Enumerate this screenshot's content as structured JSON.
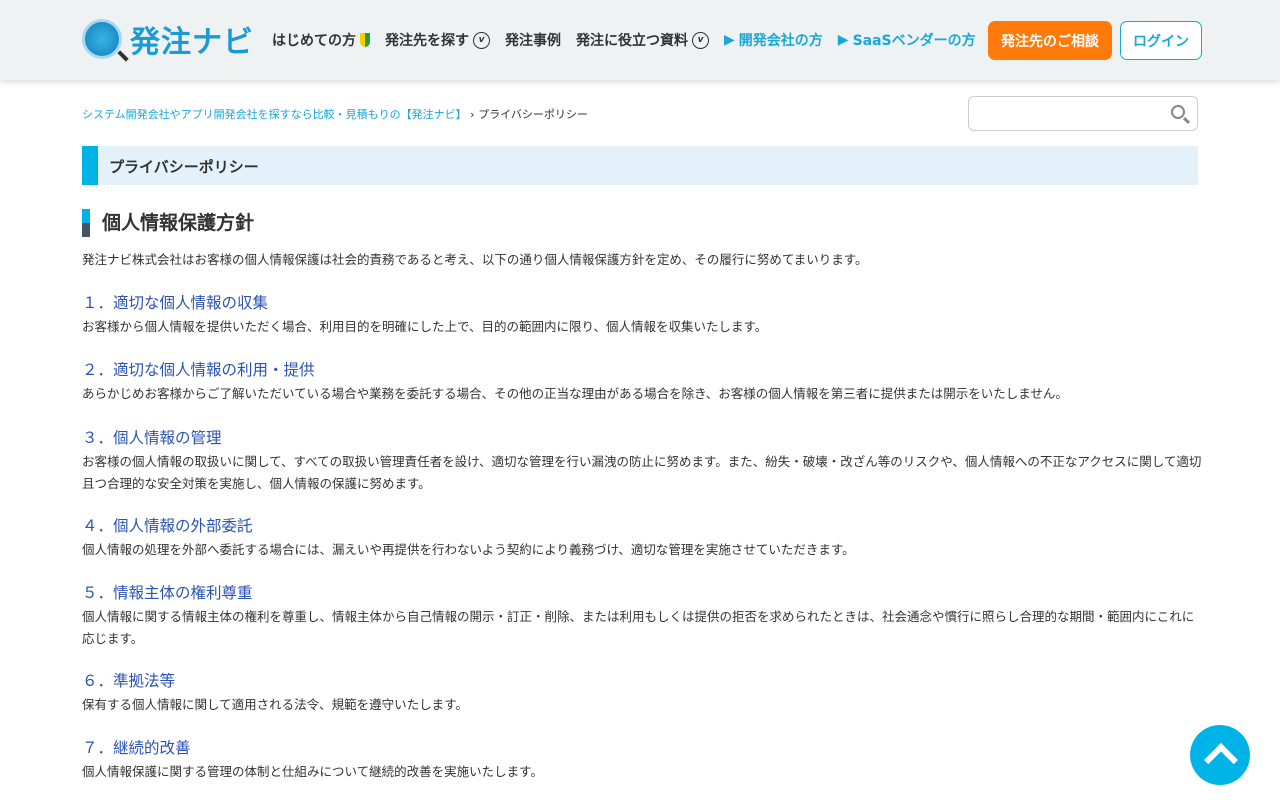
{
  "header": {
    "logo": "発注ナビ",
    "nav": [
      "はじめての方",
      "発注先を探す",
      "発注事例",
      "発注に役立つ資料",
      "開発会社の方",
      "SaaSベンダーの方"
    ],
    "consult_button": "発注先のご相談",
    "login_button": "ログイン"
  },
  "breadcrumb": {
    "home": "システム開発会社やアプリ開発会社を探すなら比較・見積もりの【発注ナビ】",
    "separator": "›",
    "current": "プライバシーポリシー"
  },
  "search": {
    "placeholder": ""
  },
  "page_title": "プライバシーポリシー",
  "heading": "個人情報保護方針",
  "intro": "発注ナビ株式会社はお客様の個人情報保護は社会的責務であると考え、以下の通り個人情報保護方針を定め、その履行に努めてまいります。",
  "sections": [
    {
      "title": "１．適切な個人情報の収集",
      "body": "お客様から個人情報を提供いただく場合、利用目的を明確にした上で、目的の範囲内に限り、個人情報を収集いたします。"
    },
    {
      "title": "２．適切な個人情報の利用・提供",
      "body": "あらかじめお客様からご了解いただいている場合や業務を委託する場合、その他の正当な理由がある場合を除き、お客様の個人情報を第三者に提供または開示をいたしません。"
    },
    {
      "title": "３．個人情報の管理",
      "body": "お客様の個人情報の取扱いに関して、すべての取扱い管理責任者を設け、適切な管理を行い漏洩の防止に努めます。また、紛失・破壊・改ざん等のリスクや、個人情報への不正なアクセスに関して適切且つ合理的な安全対策を実施し、個人情報の保護に努めます。"
    },
    {
      "title": "４．個人情報の外部委託",
      "body": "個人情報の処理を外部へ委託する場合には、漏えいや再提供を行わないよう契約により義務づけ、適切な管理を実施させていただきます。"
    },
    {
      "title": "５．情報主体の権利尊重",
      "body": "個人情報に関する情報主体の権利を尊重し、情報主体から自己情報の開示・訂正・削除、または利用もしくは提供の拒否を求められたときは、社会通念や慣行に照らし合理的な期間・範囲内にこれに応じます。"
    },
    {
      "title": "６．準拠法等",
      "body": "保有する個人情報に関して適用される法令、規範を遵守いたします。"
    },
    {
      "title": "７．継続的改善",
      "body": "個人情報保護に関する管理の体制と仕組みについて継続的改善を実施いたします。"
    }
  ]
}
